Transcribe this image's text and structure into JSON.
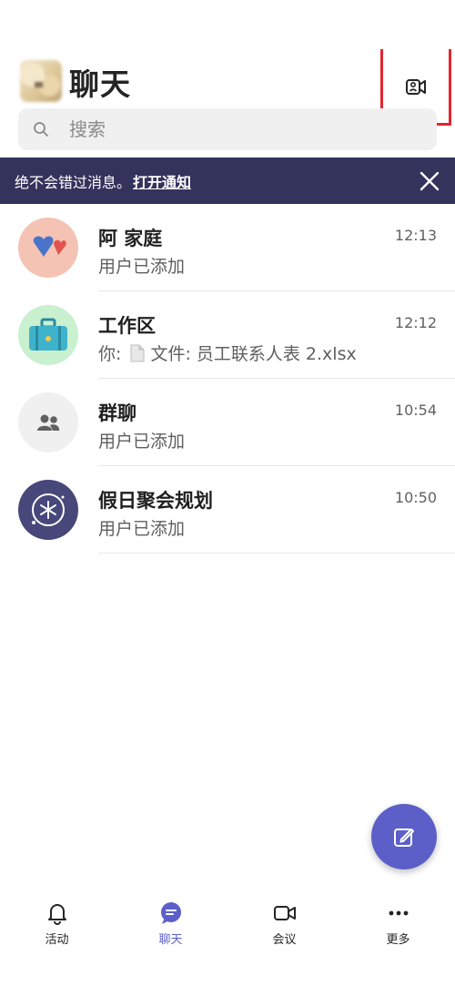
{
  "header": {
    "title": "聊天",
    "meet_icon": "meet-now-icon"
  },
  "search": {
    "placeholder": "搜索",
    "icon": "search-icon"
  },
  "banner": {
    "text": "绝不会错过消息。",
    "link": "打开通知",
    "close_icon": "close-icon"
  },
  "chats": [
    {
      "name": "阿 家庭",
      "time": "12:13",
      "preview": "用户已添加"
    },
    {
      "name": "工作区",
      "time": "12:12",
      "preview_prefix": "你:",
      "preview": "文件: 员工联系人表 2.xlsx"
    },
    {
      "name": "群聊",
      "time": "10:54",
      "preview": "用户已添加"
    },
    {
      "name": "假日聚会规划",
      "time": "10:50",
      "preview": "用户已添加"
    }
  ],
  "fab": {
    "icon": "compose-icon"
  },
  "nav": [
    {
      "label": "活动",
      "icon": "bell-icon"
    },
    {
      "label": "聊天",
      "icon": "chat-icon",
      "active": true
    },
    {
      "label": "会议",
      "icon": "video-icon"
    },
    {
      "label": "更多",
      "icon": "more-icon"
    }
  ],
  "colors": {
    "accent": "#5b5fc7",
    "banner_bg": "#33335c",
    "highlight_box": "#e3262e"
  }
}
